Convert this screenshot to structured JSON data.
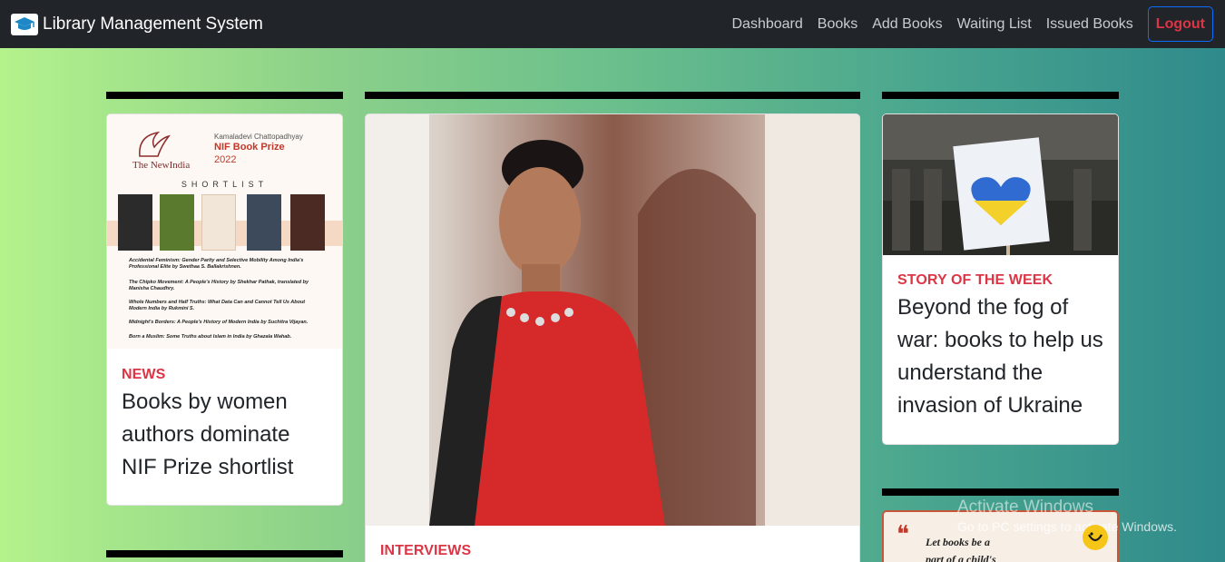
{
  "navbar": {
    "brand_icon": "graduation-cap-icon",
    "brand_title": "Library Management System",
    "links": [
      "Dashboard",
      "Books",
      "Add Books",
      "Waiting List",
      "Issued Books"
    ],
    "logout_label": "Logout"
  },
  "cards": {
    "left": {
      "category": "NEWS",
      "headline": "Books by women authors dominate NIF Prize shortlist",
      "image": {
        "foundation": "The NewIndia",
        "eyebrow": "Kamaladevi Chattopadhyay",
        "prize_title": "NIF Book Prize",
        "year": "2022",
        "shortlist": "SHORTLIST",
        "entries": [
          "Accidental Feminism: Gender Parity and Selective Mobility Among India's Professional Elite by Swethaa S. Ballakrishnen.",
          "The Chipko Movement: A People's History by Shekhar Pathak, translated by Manisha Chaudhry.",
          "Whole Numbers and Half Truths: What Data Can and Cannot Tell Us About Modern India by Rukmini S.",
          "Midnight's Borders: A People's History of Modern India by Suchitra Vijayan.",
          "Born a Muslim: Some Truths about Islam in India by Ghazala Wahab."
        ]
      }
    },
    "center": {
      "category": "INTERVIEWS"
    },
    "right": {
      "category": "STORY OF THE WEEK",
      "headline": "Beyond the fog of war: books to help us understand the invasion of Ukraine"
    },
    "right_bottom": {
      "quote": "Let books be a part of a child's"
    }
  },
  "watermark": {
    "title": "Activate Windows",
    "subtitle": "Go to PC settings to activate Windows."
  },
  "colors": {
    "navbar_bg": "#212529",
    "category_red": "#dc3545",
    "logout_border": "#0d6efd"
  }
}
